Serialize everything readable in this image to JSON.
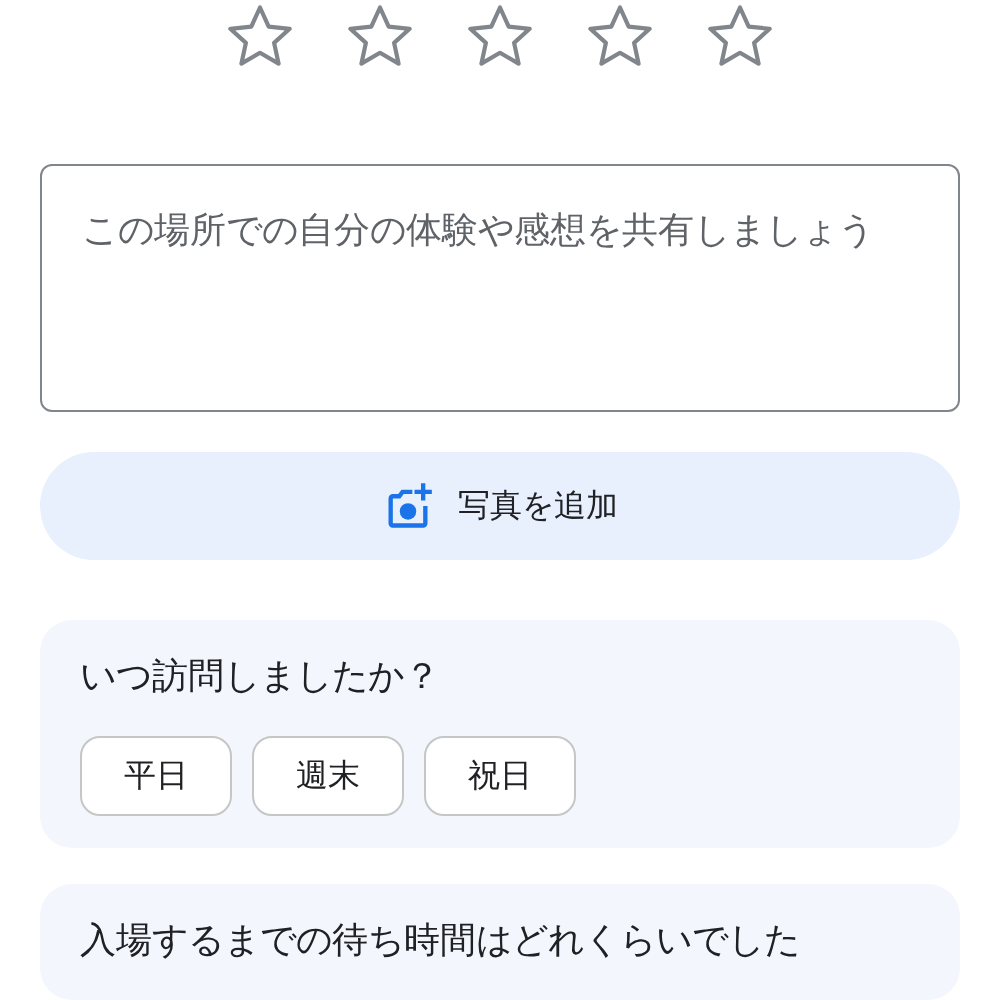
{
  "rating": {
    "stars": 0
  },
  "review": {
    "placeholder": "この場所での自分の体験や感想を共有しましょう"
  },
  "add_photo_button": {
    "label": "写真を追加"
  },
  "questions": [
    {
      "question": "いつ訪問しましたか？",
      "options": [
        {
          "label": "平日",
          "selected": false
        },
        {
          "label": "週末",
          "selected": false
        },
        {
          "label": "祝日",
          "selected": false
        }
      ]
    },
    {
      "question": "入場するまでの待ち時間はどれくらいでした"
    }
  ]
}
